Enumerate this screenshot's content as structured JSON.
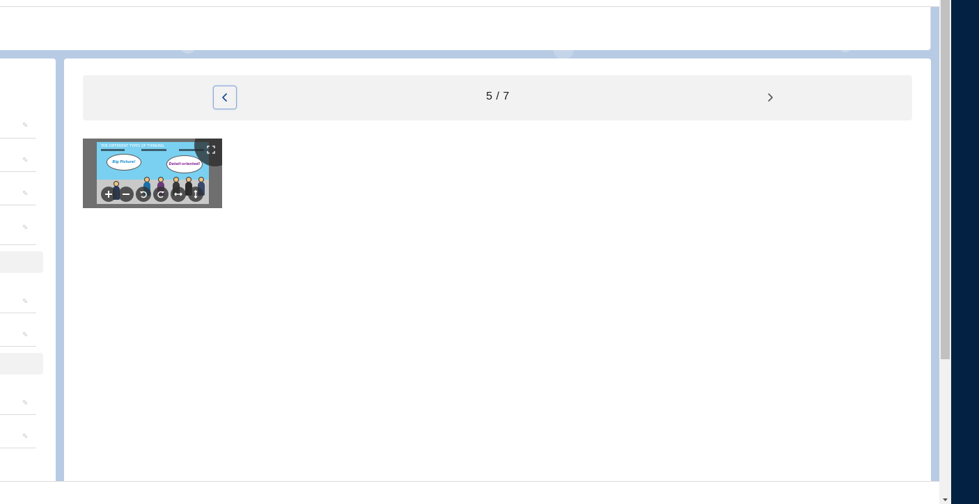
{
  "pager": {
    "page_text": "5 / 7",
    "prev_icon": "chevron-left-icon",
    "next_icon": "chevron-right-icon"
  },
  "thumbnail": {
    "slide_title": "THE DIFFERENT TYPES OF THINKING",
    "bubble_left": "Big Picture!",
    "bubble_right": "Detail-oriented!",
    "toolbar_icons": [
      "zoom-in-icon",
      "zoom-out-icon",
      "rotate-left-icon",
      "rotate-right-icon",
      "flip-horizontal-icon",
      "flip-vertical-icon"
    ],
    "fullscreen_icon": "fullscreen-icon"
  },
  "colors": {
    "backdrop": "#b7cbe4",
    "accent_border": "#8aa8d6",
    "dark_sidebar": "#032142",
    "pager_bg": "#f3f2f2"
  }
}
